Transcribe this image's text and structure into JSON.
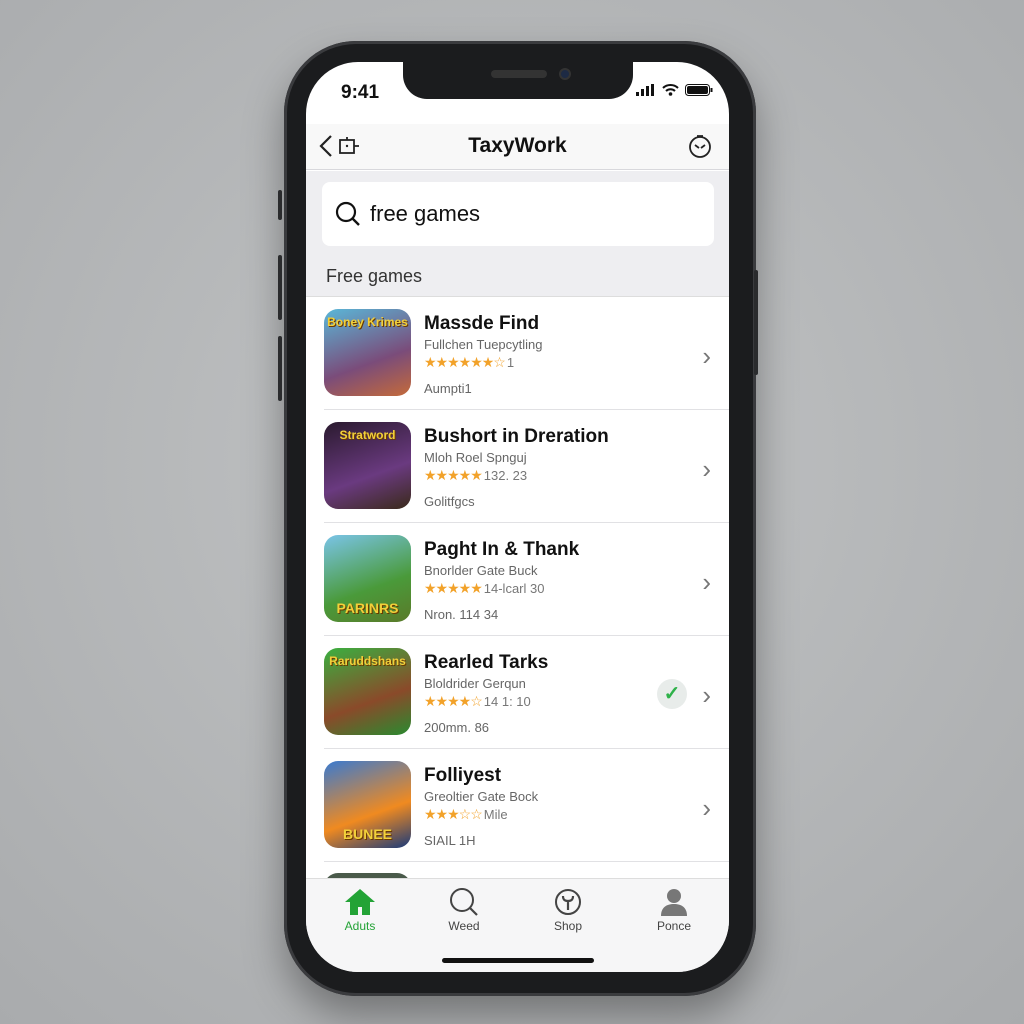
{
  "status": {
    "time": "9:41"
  },
  "nav": {
    "title": "TaxyWork"
  },
  "search": {
    "value": "free games"
  },
  "section": "Free games",
  "apps": [
    {
      "icon_text": "Boney Krimes",
      "title": "Massde Find",
      "subtitle": "Fullchen Tuepcytling",
      "stars": "★★★★★★☆",
      "rating_text": "1",
      "meta": "Aumpti1",
      "colors": [
        "#5ab7d8",
        "#7a4c7a",
        "#c46a3a"
      ]
    },
    {
      "icon_text": "Stratword",
      "title": "Bushort in Dreration",
      "subtitle": "Mloh Roel Spnguj",
      "stars": "★★★★★",
      "rating_text": "132. 23",
      "meta": "Golitfgcs",
      "colors": [
        "#2a1a2e",
        "#6a3a80",
        "#3a2a1a"
      ]
    },
    {
      "icon_text": "PARINRS",
      "title": "Paght In & Thank",
      "subtitle": "Bnorlder Gate Buck",
      "stars": "★★★★★",
      "rating_text": "14-lcarl 30",
      "meta": "Nron. 114 34",
      "colors": [
        "#7ac4e8",
        "#4a9a3a",
        "#5a7a2a"
      ]
    },
    {
      "icon_text": "Raruddshans",
      "title": "Rearled Tarks",
      "subtitle": "Bloldrider Gerqun",
      "stars": "★★★★☆",
      "rating_text": "14 1: 10",
      "meta": "200mm. 86",
      "colors": [
        "#3ab040",
        "#8a4a2a",
        "#2a8a30"
      ],
      "checked": true
    },
    {
      "icon_text": "BUNEE",
      "title": "Folliyest",
      "subtitle": "Greoltier Gate Bock",
      "stars": "★★★☆☆",
      "rating_text": "Mile",
      "meta": "SIAIL 1H",
      "colors": [
        "#3a7ad0",
        "#f08a20",
        "#1a3a7a"
      ]
    }
  ],
  "tabs": [
    {
      "label": "Aduts",
      "icon": "home-icon",
      "active": true
    },
    {
      "label": "Weed",
      "icon": "search-icon"
    },
    {
      "label": "Shop",
      "icon": "tool-icon"
    },
    {
      "label": "Ponce",
      "icon": "person-icon"
    }
  ],
  "colors": {
    "accent": "#23a336",
    "star": "#f2a22a"
  }
}
